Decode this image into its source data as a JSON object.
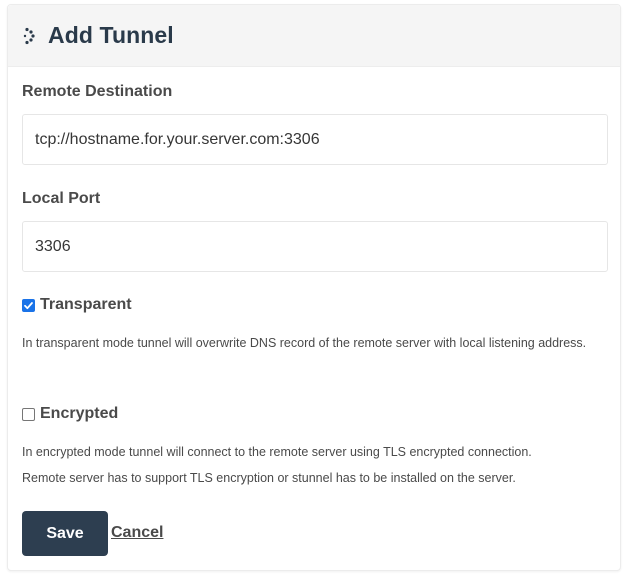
{
  "header": {
    "title": "Add Tunnel",
    "icon": "spinner-dots-icon"
  },
  "form": {
    "remote_destination": {
      "label": "Remote Destination",
      "value": "tcp://hostname.for.your.server.com:3306"
    },
    "local_port": {
      "label": "Local Port",
      "value": "3306"
    },
    "transparent": {
      "label": "Transparent",
      "checked": true,
      "help": "In transparent mode tunnel will overwrite DNS record of the remote server with local listening address."
    },
    "encrypted": {
      "label": "Encrypted",
      "checked": false,
      "help_line1": "In encrypted mode tunnel will connect to the remote server using TLS encrypted connection.",
      "help_line2": "Remote server has to support TLS encryption or stunnel has to be installed on the server."
    }
  },
  "actions": {
    "save_label": "Save",
    "cancel_label": "Cancel"
  },
  "colors": {
    "header_bg": "#f5f5f5",
    "title": "#2a3a4a",
    "save_button_bg": "#2d3e50",
    "checkbox_checked": "#1a73e8"
  }
}
